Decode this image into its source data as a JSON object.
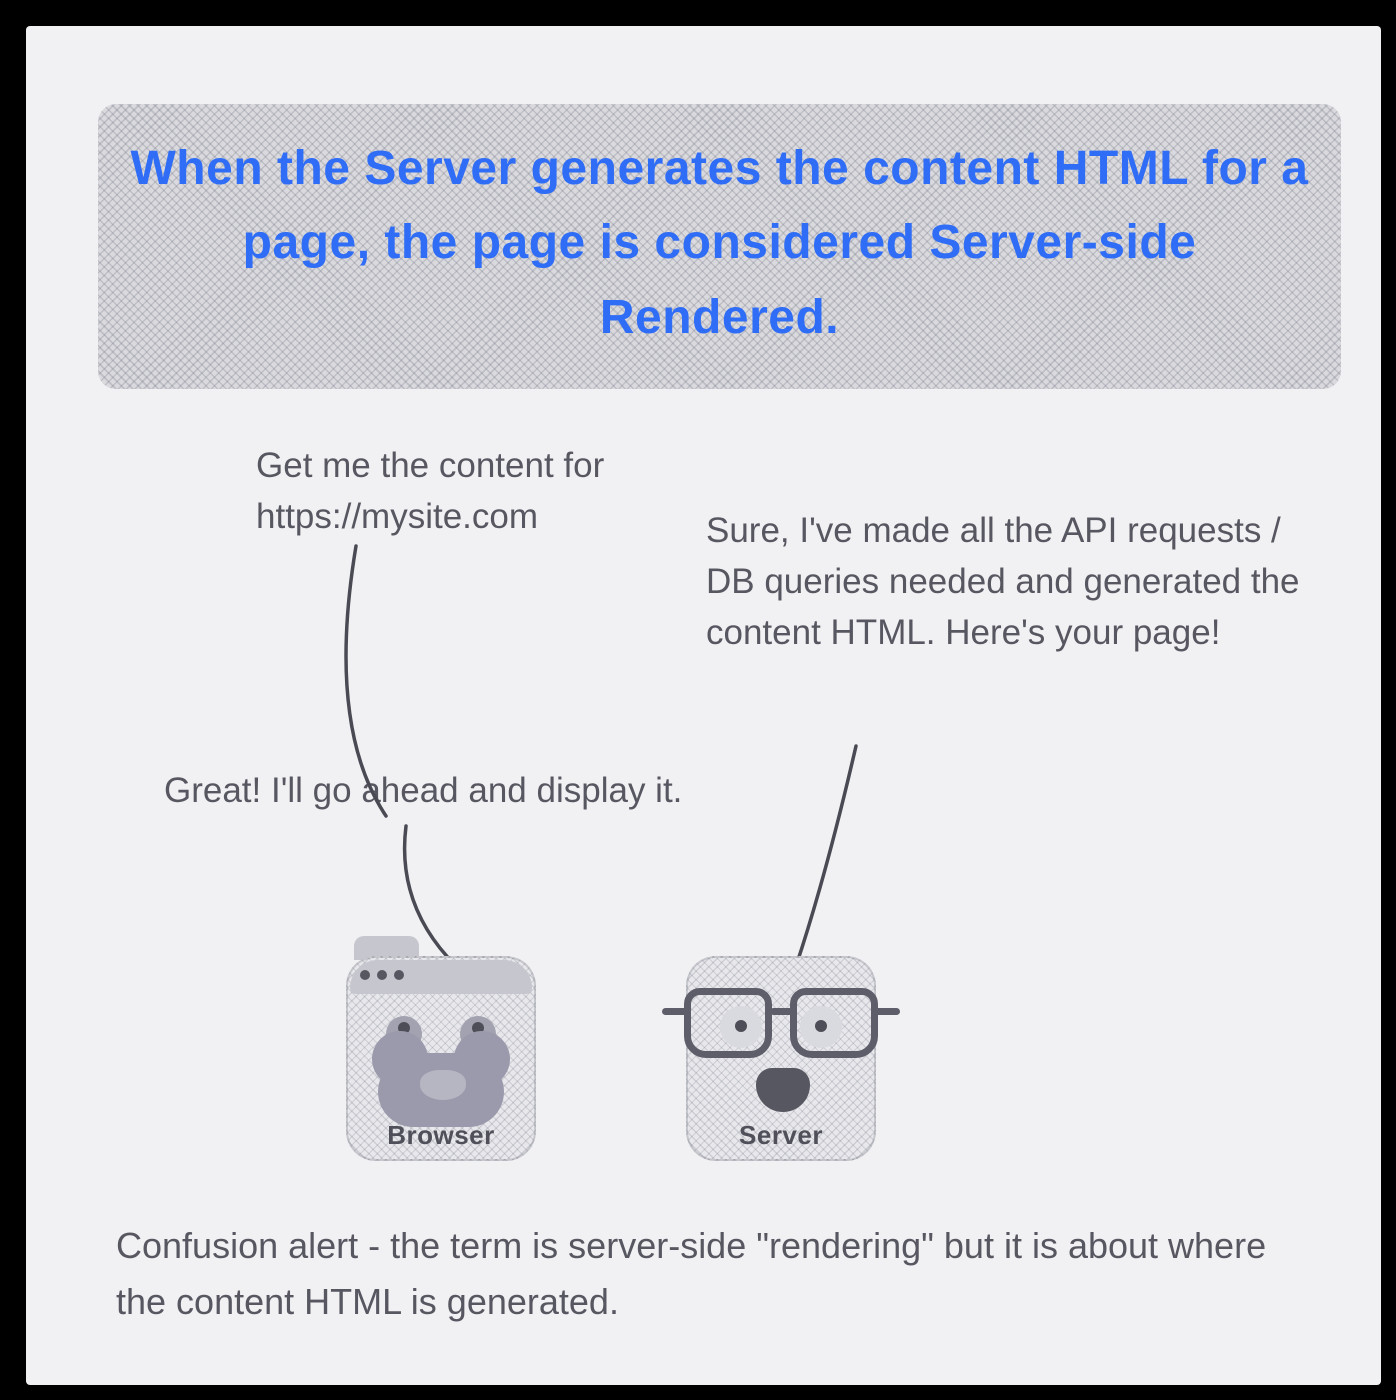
{
  "heading": "When the Server generates the content HTML for a page, the page is considered Server-side Rendered.",
  "dialogue": {
    "browser_request": "Get me the content for https://mysite.com",
    "server_response": "Sure, I've made all the API requests / DB queries needed and generated the content HTML. Here's your page!",
    "browser_ack": "Great! I'll go ahead and display it."
  },
  "characters": {
    "browser_label": "Browser",
    "server_label": "Server"
  },
  "footnote": "Confusion alert - the term is server-side \"rendering\" but it is about where the content HTML is generated.",
  "colors": {
    "heading": "#2f6df6",
    "body_text": "#575761",
    "page_bg": "#f1f1f3"
  }
}
